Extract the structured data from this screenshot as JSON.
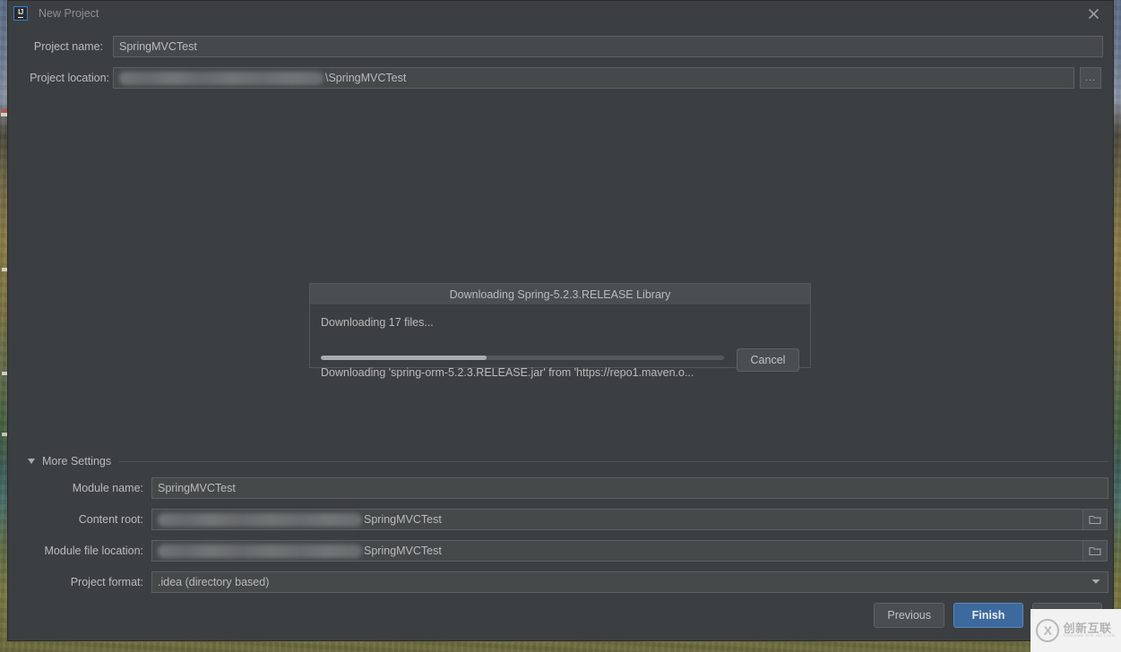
{
  "window": {
    "title": "New Project",
    "app_icon": "IJ",
    "close_icon": "close-icon"
  },
  "form": {
    "project_name": {
      "label": "Project name:",
      "value": "SpringMVCTest"
    },
    "project_location": {
      "label": "Project location:",
      "value_redacted": true,
      "value_suffix": "\\SpringMVCTest",
      "browse_label": "..."
    }
  },
  "more_settings": {
    "label": "More Settings",
    "expanded": true,
    "toggle_icon": "chevron-down-icon",
    "fields": [
      {
        "label": "Module name:",
        "value": "SpringMVCTest",
        "redacted": false,
        "trailing_icon": "none"
      },
      {
        "label": "Content root:",
        "value": "SpringMVCTest",
        "redacted": true,
        "trailing_icon": "folder-icon"
      },
      {
        "label": "Module file location:",
        "value": "SpringMVCTest",
        "redacted": true,
        "trailing_icon": "folder-icon"
      },
      {
        "label": "Project format:",
        "value": ".idea (directory based)",
        "redacted": false,
        "trailing_icon": "chevron-down-icon"
      }
    ]
  },
  "buttons": {
    "previous": "Previous",
    "finish": "Finish",
    "cancel": "Cancel"
  },
  "download_dialog": {
    "title": "Downloading Spring-5.2.3.RELEASE Library",
    "status": "Downloading 17 files...",
    "detail": "Downloading 'spring-orm-5.2.3.RELEASE.jar' from 'https://repo1.maven.o...",
    "cancel_label": "Cancel",
    "progress_percent": 41
  },
  "watermark": {
    "logo_glyph": "X",
    "chinese": "创新互联",
    "pinyin": "CHUANG XIN HU LIAN"
  },
  "colors": {
    "dialog_bg": "#3c3f41",
    "field_bg": "#45494a",
    "text": "#bbbbbb",
    "primary_button": "#3c6a9e",
    "progress_fill": "#a9acad"
  }
}
